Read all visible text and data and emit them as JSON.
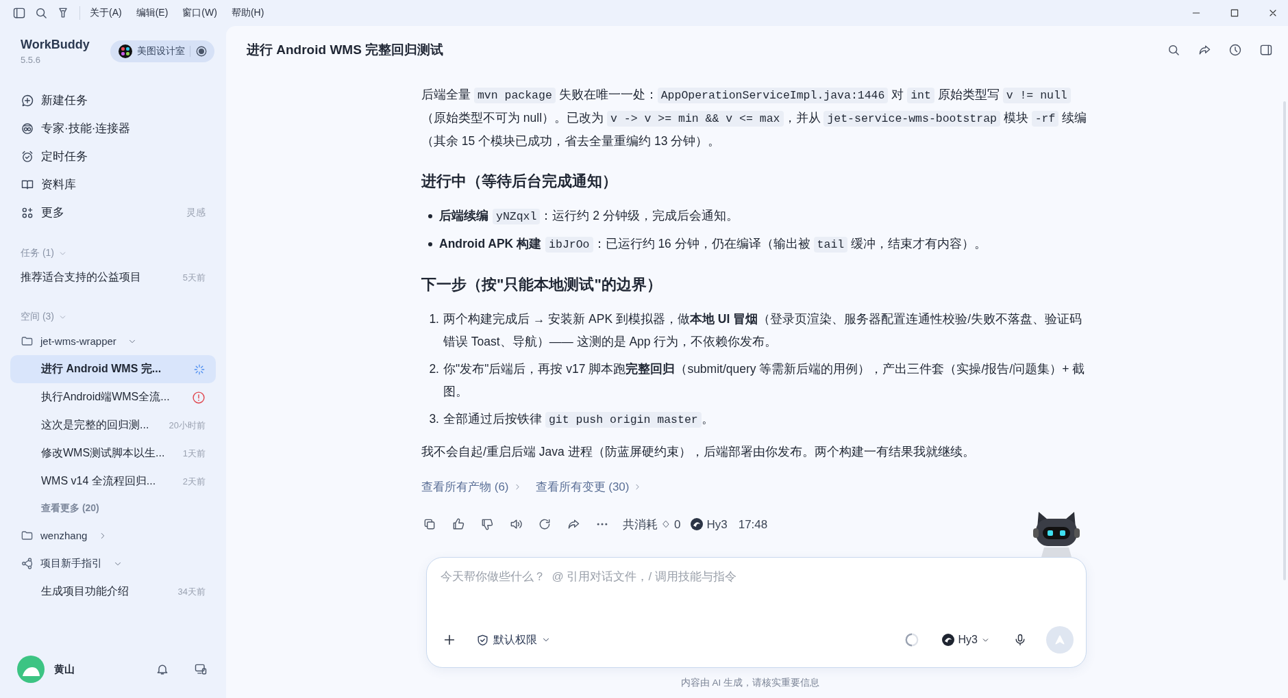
{
  "menu_bar": {
    "items": [
      "关于(A)",
      "编辑(E)",
      "窗口(W)",
      "帮助(H)"
    ]
  },
  "sidebar": {
    "app_name": "WorkBuddy",
    "version": "5.5.6",
    "workspace": "美图设计室",
    "nav": [
      {
        "label": "新建任务"
      },
      {
        "label": "专家·技能·连接器"
      },
      {
        "label": "定时任务"
      },
      {
        "label": "资料库"
      },
      {
        "label": "更多",
        "hint": "灵感"
      }
    ],
    "tasks_label": "任务 (1)",
    "tasks": [
      {
        "title": "推荐适合支持的公益项目",
        "time": "5天前"
      }
    ],
    "spaces_label": "空间 (3)",
    "spaces": [
      {
        "name": "jet-wms-wrapper",
        "kind": "folder",
        "expanded": true,
        "more": "查看更多 (20)",
        "children": [
          {
            "title": "进行 Android WMS 完...",
            "running": true,
            "error": false,
            "selected": true
          },
          {
            "title": "执行Android端WMS全流...",
            "running": false,
            "error": true,
            "selected": false
          },
          {
            "title": "这次是完整的回归测...",
            "time": "20小时前",
            "running": false,
            "error": false,
            "selected": false
          },
          {
            "title": "修改WMS测试脚本以生...",
            "time": "1天前",
            "running": false,
            "error": false,
            "selected": false
          },
          {
            "title": "WMS v14 全流程回归...",
            "time": "2天前",
            "running": false,
            "error": false,
            "selected": false
          }
        ]
      },
      {
        "name": "wenzhang",
        "kind": "folder",
        "expanded": false
      },
      {
        "name": "项目新手指引",
        "kind": "guide",
        "expanded": true,
        "children": [
          {
            "title": "生成项目功能介绍",
            "time": "34天前",
            "running": false,
            "error": false,
            "selected": false
          }
        ]
      }
    ],
    "user": {
      "name": "黄山"
    }
  },
  "main": {
    "title": "进行 Android WMS 完整回归测试",
    "blocks": [
      {
        "kind": "paragraph",
        "parts": [
          {
            "kind": "text",
            "text": "后端全量 "
          },
          {
            "kind": "code",
            "text": "mvn package"
          },
          {
            "kind": "text",
            "text": " 失败在唯一一处："
          },
          {
            "kind": "code",
            "text": "AppOperationServiceImpl.java:1446"
          },
          {
            "kind": "text",
            "text": " 对 "
          },
          {
            "kind": "code",
            "text": "int"
          },
          {
            "kind": "text",
            "text": " 原始类型写 "
          },
          {
            "kind": "code",
            "text": "v != null"
          },
          {
            "kind": "text",
            "text": "（原始类型不可为 null）。已改为 "
          },
          {
            "kind": "code",
            "text": "v -> v >= min && v <= max"
          },
          {
            "kind": "text",
            "text": "，并从 "
          },
          {
            "kind": "code",
            "text": "jet-service-wms-bootstrap"
          },
          {
            "kind": "text",
            "text": " 模块 "
          },
          {
            "kind": "code",
            "text": "-rf"
          },
          {
            "kind": "text",
            "text": " 续编（其余 15 个模块已成功，省去全量重编约 13 分钟）。"
          }
        ]
      },
      {
        "kind": "heading",
        "text": "进行中（等待后台完成通知）"
      },
      {
        "kind": "bullets",
        "items": [
          {
            "parts": [
              {
                "kind": "bold",
                "text": "后端续编"
              },
              {
                "kind": "code",
                "text": "yNZqxl"
              },
              {
                "kind": "text",
                "text": "：运行约 2 分钟级，完成后会通知。"
              }
            ]
          },
          {
            "parts": [
              {
                "kind": "bold",
                "text": "Android APK 构建"
              },
              {
                "kind": "code",
                "text": "ibJrOo"
              },
              {
                "kind": "text",
                "text": "：已运行约 16 分钟，仍在编译（输出被 "
              },
              {
                "kind": "code",
                "text": "tail"
              },
              {
                "kind": "text",
                "text": " 缓冲，结束才有内容）。"
              }
            ]
          }
        ]
      },
      {
        "kind": "heading",
        "text": "下一步（按\"只能本地测试\"的边界）"
      },
      {
        "kind": "numbered",
        "items": [
          {
            "marker": "1.",
            "parts": [
              {
                "kind": "text",
                "text": "两个构建完成后 → 安装新 APK 到模拟器，做"
              },
              {
                "kind": "bold",
                "text": "本地 UI 冒烟"
              },
              {
                "kind": "text",
                "text": "（登录页渲染、服务器配置连通性校验/失败不落盘、验证码错误 Toast、导航）—— 这测的是 App 行为，不依赖你发布。"
              }
            ]
          },
          {
            "marker": "2.",
            "parts": [
              {
                "kind": "text",
                "text": "你\"发布\"后端后，再按 v17 脚本跑"
              },
              {
                "kind": "bold",
                "text": "完整回归"
              },
              {
                "kind": "text",
                "text": "（submit/query 等需新后端的用例），产出三件套（实操/报告/问题集）+ 截图。"
              }
            ]
          },
          {
            "marker": "3.",
            "parts": [
              {
                "kind": "text",
                "text": "全部通过后按铁律 "
              },
              {
                "kind": "code",
                "text": "git push origin master"
              },
              {
                "kind": "text",
                "text": "。"
              }
            ]
          }
        ]
      },
      {
        "kind": "paragraph",
        "parts": [
          {
            "kind": "text",
            "text": "我不会自起/重启后端 Java 进程（防蓝屏硬约束），后端部署由你发布。两个构建一有结果我就继续。"
          }
        ]
      }
    ],
    "links": [
      "查看所有产物 (6)",
      "查看所有变更 (30)"
    ],
    "meta": {
      "cost_label": "共消耗",
      "cost": "0",
      "model": "Hy3",
      "time": "17:48"
    }
  },
  "composer": {
    "placeholder": "今天帮你做些什么？  @ 引用对话文件，/ 调用技能与指令",
    "permission": "默认权限",
    "model": "Hy3"
  },
  "disclaimer": "内容由 AI 生成，请核实重要信息"
}
